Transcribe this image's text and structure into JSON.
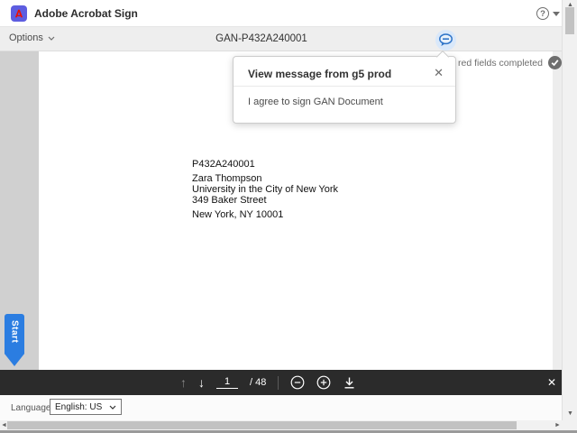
{
  "header": {
    "app_title": "Adobe Acrobat Sign",
    "help_glyph": "?"
  },
  "options_bar": {
    "options_label": "Options",
    "document_title": "GAN-P432A240001"
  },
  "status": {
    "completed_text": "red fields completed"
  },
  "popup": {
    "title": "View message from g5 prod",
    "body": "I agree to sign GAN Document",
    "close_glyph": "✕"
  },
  "document": {
    "lines": [
      "P432A240001",
      "Zara Thompson",
      "University in the City of New York",
      "349 Baker Street",
      "New York, NY 10001"
    ]
  },
  "start_tab": {
    "label": "Start"
  },
  "toolbar": {
    "page_value": "1",
    "page_total": "/ 48",
    "up_glyph": "↑",
    "down_glyph": "↓",
    "close_glyph": "✕"
  },
  "footer": {
    "language_label": "Language",
    "language_value": "English: US"
  },
  "scrollbars": {
    "up_glyph": "▲",
    "down_glyph": "▼",
    "left_glyph": "◄",
    "right_glyph": "►"
  },
  "colors": {
    "accent_blue": "#2b7de1",
    "logo_purple": "#5d5de0",
    "logo_red": "#eb1000",
    "toolbar_bg": "#2b2b2b",
    "options_bar_bg": "#eeeeee",
    "gutter_gray": "#d0d0d0",
    "check_gray": "#6e6e6e",
    "message_blue": "#2e74c8"
  }
}
